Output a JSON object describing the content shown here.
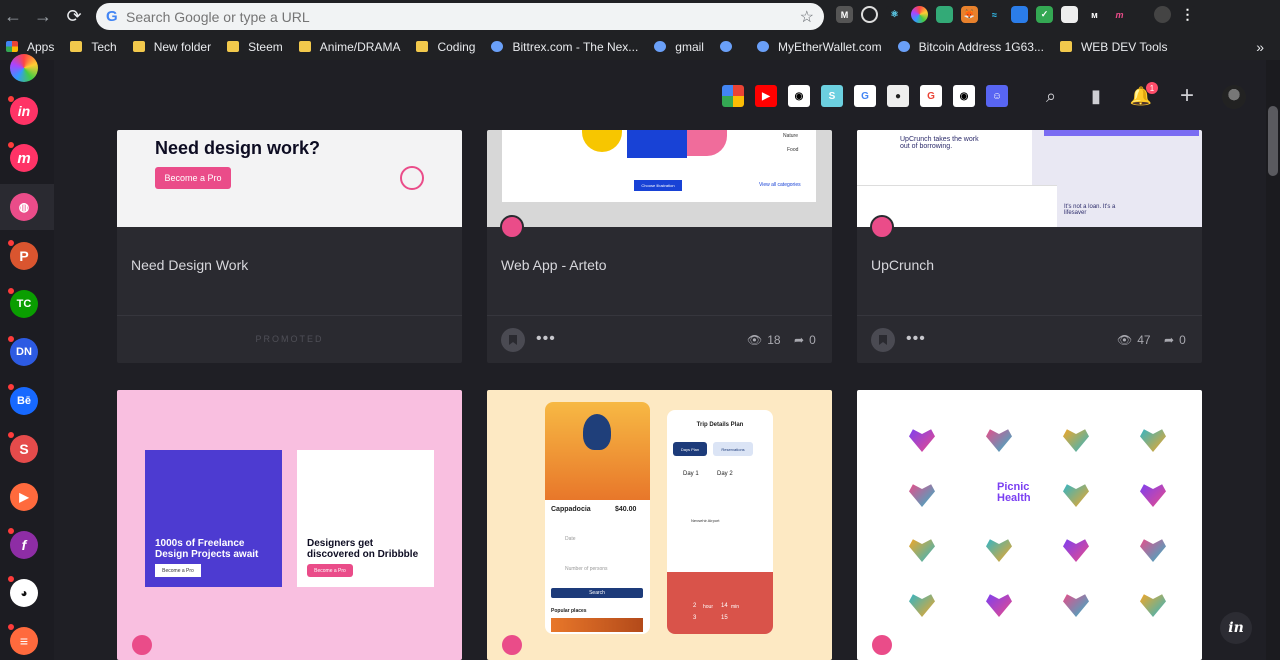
{
  "browser": {
    "search_placeholder": "Search Google or type a URL",
    "bookmarks": [
      {
        "label": "Apps",
        "kind": "apps"
      },
      {
        "label": "Tech",
        "kind": "folder"
      },
      {
        "label": "New folder",
        "kind": "folder"
      },
      {
        "label": "Steem",
        "kind": "folder"
      },
      {
        "label": "Anime/DRAMA",
        "kind": "folder"
      },
      {
        "label": "Coding",
        "kind": "folder"
      },
      {
        "label": "Bittrex.com - The Nex...",
        "kind": "site"
      },
      {
        "label": "gmail",
        "kind": "site"
      },
      {
        "label": "",
        "kind": "site"
      },
      {
        "label": "MyEtherWallet.com",
        "kind": "site"
      },
      {
        "label": "Bitcoin Address 1G63...",
        "kind": "site"
      },
      {
        "label": "WEB DEV Tools",
        "kind": "folder"
      }
    ],
    "more_label": "»"
  },
  "header": {
    "notification_count": "1"
  },
  "cards_top": [
    {
      "title": "Need Design Work",
      "footer": "PROMOTED",
      "thumb_heading": "Need design work?",
      "thumb_button": "Become a Pro"
    },
    {
      "title": "Web App - Arteto",
      "views": "18",
      "shares": "0",
      "thumb_button": "Choose Illustration",
      "thumb_link": "View all categories",
      "thumb_side1": "Nature",
      "thumb_side2": "Food"
    },
    {
      "title": "UpCrunch",
      "views": "47",
      "shares": "0",
      "thumb_heading": "UpCrunch takes the work out of borrowing.",
      "thumb_tag": "It's not a loan. It's a lifesaver"
    }
  ],
  "cards_bottom": [
    {
      "left_heading": "1000s of Freelance Design Projects await",
      "right_heading": "Designers get discovered on Dribbble",
      "button": "Become a Pro"
    },
    {
      "place": "Cappadocia",
      "price": "$40.00",
      "plan_title": "Trip Details Plan",
      "tab1": "Days Plan",
      "tab2": "Reservations",
      "day1": "Day 1",
      "day2": "Day 2",
      "airport": "Nevsehir Airport",
      "search": "Search",
      "popular": "Popular places",
      "date_label": "Date",
      "persons_label": "Number of persons",
      "hour_label": "hour",
      "min_label": "min",
      "hour_val": "2",
      "min_val": "14",
      "hour_next": "3",
      "min_next": "15"
    },
    {
      "logo_text": "Picnic Health"
    }
  ],
  "colors": {
    "dribbble": "#ea4c89",
    "bg": "#1f1f25",
    "card": "#2a2a30"
  }
}
